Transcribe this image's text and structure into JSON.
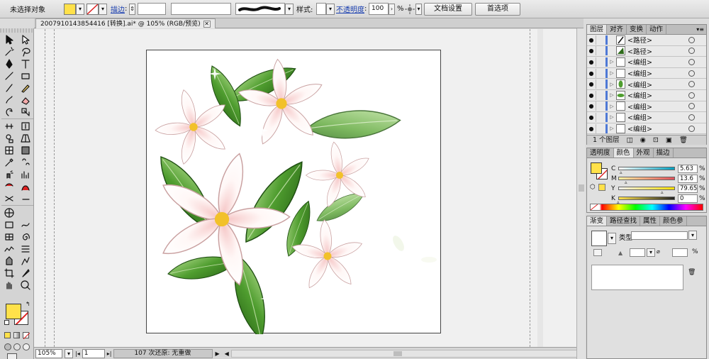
{
  "control_bar": {
    "selection_status": "未选择对象",
    "stroke_label": "描边",
    "opacity_value": "100",
    "style_label": "样式:",
    "opacity_label": "不透明度",
    "percent": "%",
    "doc_settings_button": "文档设置",
    "preferences_button": "首选项",
    "fill_color": "#ffe14a",
    "dropdown_arrow": "▾"
  },
  "document": {
    "tab_title": "2007910143854416 [转换].ai* @ 105% (RGB/预览)",
    "close_glyph": "✕"
  },
  "status_bar": {
    "zoom": "105%",
    "page": "1",
    "status_text": "107 次还原: 无重做"
  },
  "layers_panel": {
    "tabs": [
      "图层",
      "对齐",
      "变换",
      "动作"
    ],
    "rows": [
      {
        "name": "<路径>",
        "has_triangle": false,
        "thumb": "path-dark"
      },
      {
        "name": "<路径>",
        "has_triangle": false,
        "thumb": "leaf"
      },
      {
        "name": "<编组>",
        "has_triangle": true,
        "thumb": "blank"
      },
      {
        "name": "<编组>",
        "has_triangle": true,
        "thumb": "blank"
      },
      {
        "name": "<编组>",
        "has_triangle": true,
        "thumb": "leaf-small"
      },
      {
        "name": "<编组>",
        "has_triangle": true,
        "thumb": "leaf-wide"
      },
      {
        "name": "<编组>",
        "has_triangle": true,
        "thumb": "blank"
      },
      {
        "name": "<编组>",
        "has_triangle": true,
        "thumb": "blank"
      },
      {
        "name": "<编组>",
        "has_triangle": true,
        "thumb": "blank"
      }
    ],
    "footer": "1 个图层"
  },
  "color_panel": {
    "tabs": [
      "透明度",
      "颜色",
      "外观",
      "描边"
    ],
    "channels": [
      {
        "label": "C",
        "value": "5.63",
        "from": "#ffffff",
        "to": "#00a0c0",
        "pos": 0.056
      },
      {
        "label": "M",
        "value": "13.6",
        "from": "#fff2a0",
        "to": "#e0505a",
        "pos": 0.136
      },
      {
        "label": "Y",
        "value": "79.65",
        "from": "#f0f0f0",
        "to": "#ffe000",
        "pos": 0.797
      },
      {
        "label": "K",
        "value": "0",
        "from": "#ffe14a",
        "to": "#222222",
        "pos": 0.0
      }
    ],
    "percent": "%"
  },
  "gradient_panel": {
    "tabs": [
      "渐变",
      "路径查找",
      "属性",
      "颜色参"
    ],
    "type_label": "类型:"
  },
  "icons": {
    "eye": "●",
    "triangle": "▷",
    "warning": "▲",
    "menu": "▾≡",
    "percent": "%"
  }
}
